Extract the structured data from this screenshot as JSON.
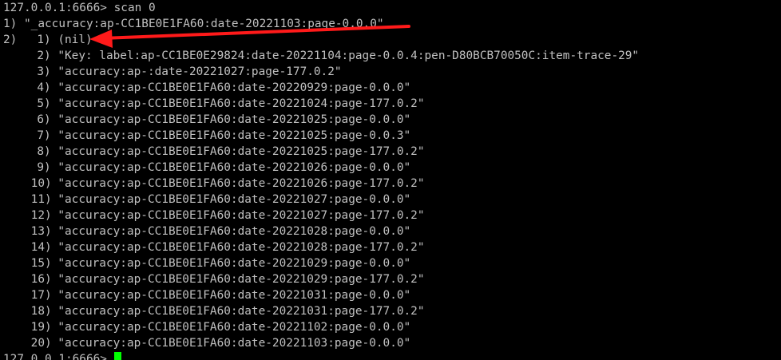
{
  "terminal": {
    "prompt_host": "127.0.0.1:6666>",
    "command": "scan 0",
    "cursor_color": "#00ff00",
    "text_color": "#c0c0c0",
    "background": "#000000",
    "annotation_arrow_color": "#ff0000",
    "annotation_arrow_icon": "red-arrow-icon"
  },
  "result": {
    "cursor_label": "1)",
    "cursor_value": "\"_accuracy:ap-CC1BE0E1FA60:date-20221103:page-0.0.0\"",
    "keys_label": "2)",
    "keys": [
      {
        "idx": "1)",
        "value": "(nil)"
      },
      {
        "idx": "2)",
        "value": "\"Key: label:ap-CC1BE0E29824:date-20221104:page-0.0.4:pen-D80BCB70050C:item-trace-29\""
      },
      {
        "idx": "3)",
        "value": "\"accuracy:ap-:date-20221027:page-177.0.2\""
      },
      {
        "idx": "4)",
        "value": "\"accuracy:ap-CC1BE0E1FA60:date-20220929:page-0.0.0\""
      },
      {
        "idx": "5)",
        "value": "\"accuracy:ap-CC1BE0E1FA60:date-20221024:page-177.0.2\""
      },
      {
        "idx": "6)",
        "value": "\"accuracy:ap-CC1BE0E1FA60:date-20221025:page-0.0.0\""
      },
      {
        "idx": "7)",
        "value": "\"accuracy:ap-CC1BE0E1FA60:date-20221025:page-0.0.3\""
      },
      {
        "idx": "8)",
        "value": "\"accuracy:ap-CC1BE0E1FA60:date-20221025:page-177.0.2\""
      },
      {
        "idx": "9)",
        "value": "\"accuracy:ap-CC1BE0E1FA60:date-20221026:page-0.0.0\""
      },
      {
        "idx": "10)",
        "value": "\"accuracy:ap-CC1BE0E1FA60:date-20221026:page-177.0.2\""
      },
      {
        "idx": "11)",
        "value": "\"accuracy:ap-CC1BE0E1FA60:date-20221027:page-0.0.0\""
      },
      {
        "idx": "12)",
        "value": "\"accuracy:ap-CC1BE0E1FA60:date-20221027:page-177.0.2\""
      },
      {
        "idx": "13)",
        "value": "\"accuracy:ap-CC1BE0E1FA60:date-20221028:page-0.0.0\""
      },
      {
        "idx": "14)",
        "value": "\"accuracy:ap-CC1BE0E1FA60:date-20221028:page-177.0.2\""
      },
      {
        "idx": "15)",
        "value": "\"accuracy:ap-CC1BE0E1FA60:date-20221029:page-0.0.0\""
      },
      {
        "idx": "16)",
        "value": "\"accuracy:ap-CC1BE0E1FA60:date-20221029:page-177.0.2\""
      },
      {
        "idx": "17)",
        "value": "\"accuracy:ap-CC1BE0E1FA60:date-20221031:page-0.0.0\""
      },
      {
        "idx": "18)",
        "value": "\"accuracy:ap-CC1BE0E1FA60:date-20221031:page-177.0.2\""
      },
      {
        "idx": "19)",
        "value": "\"accuracy:ap-CC1BE0E1FA60:date-20221102:page-0.0.0\""
      },
      {
        "idx": "20)",
        "value": "\"accuracy:ap-CC1BE0E1FA60:date-20221103:page-0.0.0\""
      }
    ]
  }
}
